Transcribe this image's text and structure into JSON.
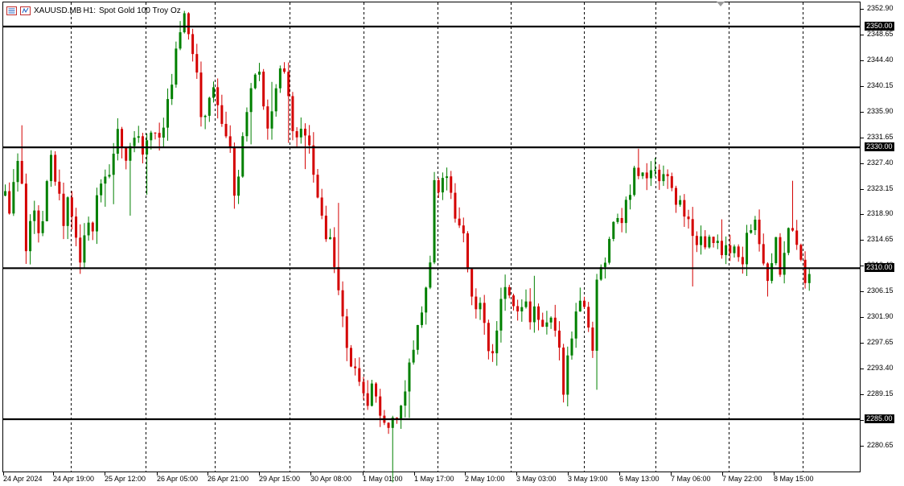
{
  "header": {
    "symbol": "XAUUSD.MB",
    "timeframe": "H1:",
    "description": "Spot Gold 100 Troy Oz"
  },
  "colors": {
    "bull": "#008000",
    "bear": "#d40000",
    "line": "#000000",
    "grid": "#000000"
  },
  "chart_data": {
    "type": "candlestick",
    "timeframe": "H1",
    "ylim": [
      2278.0,
      2354.0
    ],
    "y_ticks": [
      "2352.90",
      "2348.65",
      "2344.40",
      "2340.15",
      "2335.90",
      "2331.65",
      "2327.40",
      "2323.15",
      "2318.90",
      "2314.65",
      "2310.40",
      "2306.15",
      "2301.90",
      "2297.65",
      "2293.40",
      "2289.15",
      "2284.90",
      "2280.65"
    ],
    "x_labels": [
      "24 Apr 2024",
      "24 Apr 19:00",
      "25 Apr 12:00",
      "26 Apr 05:00",
      "26 Apr 21:00",
      "29 Apr 15:00",
      "30 Apr 08:00",
      "1 May 01:00",
      "1 May 17:00",
      "2 May 10:00",
      "3 May 03:00",
      "3 May 19:00",
      "6 May 13:00",
      "7 May 06:00",
      "7 May 22:00",
      "8 May 15:00"
    ],
    "horizontal_levels": [
      {
        "price": 2350.0,
        "label": "2350.00"
      },
      {
        "price": 2330.0,
        "label": "2330.00"
      },
      {
        "price": 2310.0,
        "label": "2310.00"
      },
      {
        "price": 2285.0,
        "label": "2285.00"
      }
    ],
    "grid": "vertical dashed",
    "series": [
      {
        "path": [
          [
            0,
            2322
          ],
          [
            8,
            2318
          ],
          [
            12,
            2330
          ],
          [
            20,
            2327
          ],
          [
            26,
            2312
          ],
          [
            34,
            2320
          ],
          [
            44,
            2315
          ],
          [
            55,
            2328
          ],
          [
            64,
            2325
          ],
          [
            72,
            2316
          ],
          [
            78,
            2322
          ],
          [
            85,
            2318
          ],
          [
            92,
            2310
          ],
          [
            100,
            2318
          ],
          [
            108,
            2314
          ],
          [
            115,
            2322
          ],
          [
            122,
            2326
          ],
          [
            130,
            2327
          ]
        ]
      },
      {
        "path": [
          [
            130,
            2327
          ],
          [
            140,
            2332
          ],
          [
            150,
            2329
          ],
          [
            160,
            2333
          ],
          [
            170,
            2329
          ],
          [
            182,
            2332
          ],
          [
            192,
            2331
          ],
          [
            200,
            2335
          ],
          [
            208,
            2342
          ],
          [
            214,
            2348
          ],
          [
            222,
            2351
          ],
          [
            228,
            2348
          ],
          [
            234,
            2346
          ],
          [
            240,
            2340
          ],
          [
            246,
            2333
          ],
          [
            252,
            2336
          ],
          [
            258,
            2340
          ],
          [
            264,
            2338
          ]
        ]
      },
      {
        "path": [
          [
            264,
            2338
          ],
          [
            270,
            2334
          ],
          [
            278,
            2331
          ],
          [
            284,
            2323
          ],
          [
            290,
            2326
          ],
          [
            296,
            2331
          ],
          [
            302,
            2338
          ],
          [
            310,
            2344
          ],
          [
            318,
            2340
          ],
          [
            326,
            2333
          ],
          [
            334,
            2337
          ],
          [
            342,
            2344
          ],
          [
            350,
            2340
          ],
          [
            358,
            2333
          ],
          [
            366,
            2332
          ],
          [
            374,
            2331
          ],
          [
            380,
            2328
          ],
          [
            386,
            2323
          ],
          [
            392,
            2318
          ],
          [
            400,
            2315
          ],
          [
            406,
            2313
          ]
        ]
      },
      {
        "path": [
          [
            406,
            2313
          ],
          [
            414,
            2307
          ],
          [
            420,
            2302
          ],
          [
            426,
            2296
          ],
          [
            432,
            2294
          ],
          [
            438,
            2291
          ],
          [
            444,
            2288
          ],
          [
            450,
            2287
          ],
          [
            456,
            2292
          ],
          [
            462,
            2288
          ],
          [
            468,
            2286
          ],
          [
            474,
            2285
          ],
          [
            480,
            2284
          ],
          [
            486,
            2285
          ],
          [
            492,
            2286
          ],
          [
            498,
            2291
          ],
          [
            504,
            2295
          ],
          [
            510,
            2298
          ],
          [
            516,
            2303
          ],
          [
            522,
            2305
          ],
          [
            528,
            2308
          ],
          [
            532,
            2326
          ],
          [
            538,
            2322
          ],
          [
            544,
            2325
          ],
          [
            550,
            2324
          ]
        ]
      },
      {
        "path": [
          [
            550,
            2324
          ],
          [
            556,
            2320
          ],
          [
            562,
            2319
          ],
          [
            568,
            2316
          ],
          [
            574,
            2312
          ],
          [
            580,
            2305
          ],
          [
            586,
            2302
          ],
          [
            592,
            2303
          ],
          [
            598,
            2299
          ],
          [
            604,
            2294
          ],
          [
            610,
            2300
          ],
          [
            616,
            2306
          ],
          [
            622,
            2308
          ],
          [
            628,
            2304
          ],
          [
            634,
            2305
          ],
          [
            640,
            2302
          ],
          [
            646,
            2304
          ],
          [
            652,
            2302
          ],
          [
            658,
            2305
          ],
          [
            664,
            2301
          ],
          [
            670,
            2299
          ],
          [
            676,
            2300
          ],
          [
            682,
            2302
          ],
          [
            688,
            2299
          ],
          [
            694,
            2290
          ],
          [
            700,
            2296
          ],
          [
            706,
            2298
          ],
          [
            712,
            2304
          ],
          [
            718,
            2303
          ],
          [
            724,
            2301
          ],
          [
            730,
            2297
          ],
          [
            736,
            2308
          ],
          [
            742,
            2310
          ]
        ]
      },
      {
        "path": [
          [
            742,
            2310
          ],
          [
            748,
            2312
          ],
          [
            754,
            2315
          ],
          [
            760,
            2320
          ],
          [
            766,
            2318
          ],
          [
            772,
            2320
          ],
          [
            778,
            2323
          ],
          [
            784,
            2329
          ],
          [
            790,
            2324
          ],
          [
            796,
            2326
          ],
          [
            802,
            2327
          ],
          [
            808,
            2325
          ],
          [
            814,
            2326
          ],
          [
            820,
            2326
          ],
          [
            826,
            2323
          ],
          [
            832,
            2322
          ],
          [
            838,
            2320
          ],
          [
            844,
            2319
          ],
          [
            850,
            2318
          ],
          [
            856,
            2315
          ],
          [
            862,
            2314
          ],
          [
            868,
            2314
          ],
          [
            874,
            2316
          ],
          [
            880,
            2313
          ],
          [
            886,
            2315
          ],
          [
            892,
            2312
          ],
          [
            898,
            2313
          ],
          [
            904,
            2312
          ],
          [
            910,
            2313
          ],
          [
            916,
            2310
          ],
          [
            922,
            2316
          ]
        ]
      },
      {
        "path": [
          [
            922,
            2316
          ],
          [
            928,
            2318
          ],
          [
            934,
            2318
          ],
          [
            940,
            2312
          ],
          [
            946,
            2307
          ],
          [
            952,
            2310
          ],
          [
            958,
            2314
          ],
          [
            964,
            2310
          ],
          [
            970,
            2314
          ],
          [
            976,
            2318
          ],
          [
            982,
            2315
          ],
          [
            988,
            2311
          ],
          [
            994,
            2308
          ],
          [
            1000,
            2309
          ]
        ]
      }
    ]
  }
}
